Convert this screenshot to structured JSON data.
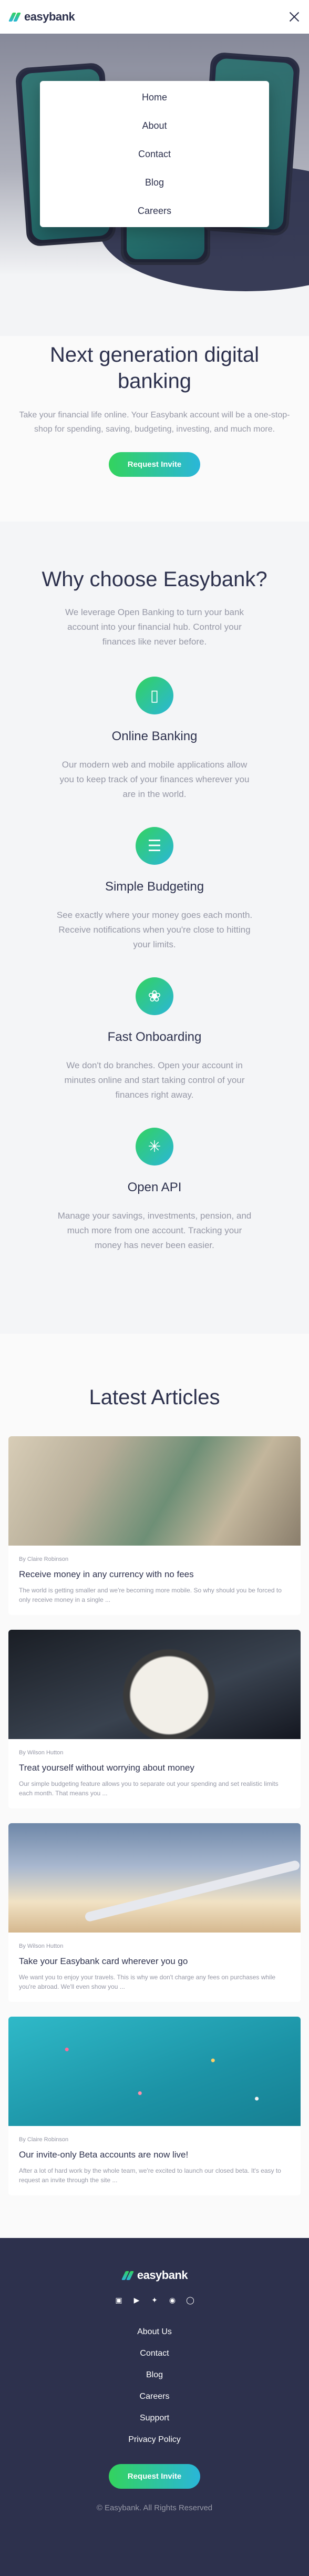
{
  "brand": {
    "name": "easybank",
    "accent_gradient": [
      "#33d35e",
      "#2ab6d9"
    ],
    "dark": "#2d314d",
    "muted": "#9698a6"
  },
  "nav": {
    "close_icon": "close-icon",
    "menu": [
      "Home",
      "About",
      "Contact",
      "Blog",
      "Careers"
    ]
  },
  "hero": {
    "title": "Next generation digital banking",
    "subtitle": "Take your financial life online. Your Easybank account will be a one-stop-shop for spending, saving, budgeting, investing, and much more.",
    "cta": "Request Invite"
  },
  "why": {
    "title": "Why choose Easybank?",
    "intro": "We leverage Open Banking to turn your bank account into your financial hub. Control your finances like never before.",
    "features": [
      {
        "icon": "online-banking-icon",
        "title": "Online Banking",
        "text": "Our modern web and mobile applications allow you to keep track of your finances wherever you are in the world."
      },
      {
        "icon": "budgeting-icon",
        "title": "Simple Budgeting",
        "text": "See exactly where your money goes each month. Receive notifications when you're close to hitting your limits."
      },
      {
        "icon": "onboarding-icon",
        "title": "Fast Onboarding",
        "text": "We don't do branches. Open your account in minutes online and start taking control of your finances right away."
      },
      {
        "icon": "api-icon",
        "title": "Open API",
        "text": "Manage your savings, investments, pension, and much more from one account. Tracking your money has never been easier."
      }
    ]
  },
  "articles": {
    "title": "Latest Articles",
    "items": [
      {
        "author": "By Claire Robinson",
        "title": "Receive money in any currency with no fees",
        "excerpt": "The world is getting smaller and we're becoming more mobile. So why should you be forced to only receive money in a single ..."
      },
      {
        "author": "By Wilson Hutton",
        "title": "Treat yourself without worrying about money",
        "excerpt": "Our simple budgeting feature allows you to separate out your spending and set realistic limits each month. That means you ..."
      },
      {
        "author": "By Wilson Hutton",
        "title": "Take your Easybank card wherever you go",
        "excerpt": "We want you to enjoy your travels. This is why we don't charge any fees on purchases while you're abroad. We'll even show you ..."
      },
      {
        "author": "By Claire Robinson",
        "title": "Our invite-only Beta accounts are now live!",
        "excerpt": "After a lot of hard work by the whole team, we're excited to launch our closed beta. It's easy to request an invite through the site ..."
      }
    ]
  },
  "footer": {
    "socials": [
      "facebook-icon",
      "youtube-icon",
      "twitter-icon",
      "pinterest-icon",
      "instagram-icon"
    ],
    "links": [
      "About Us",
      "Contact",
      "Blog",
      "Careers",
      "Support",
      "Privacy Policy"
    ],
    "cta": "Request Invite",
    "copyright": "© Easybank. All Rights Reserved"
  }
}
